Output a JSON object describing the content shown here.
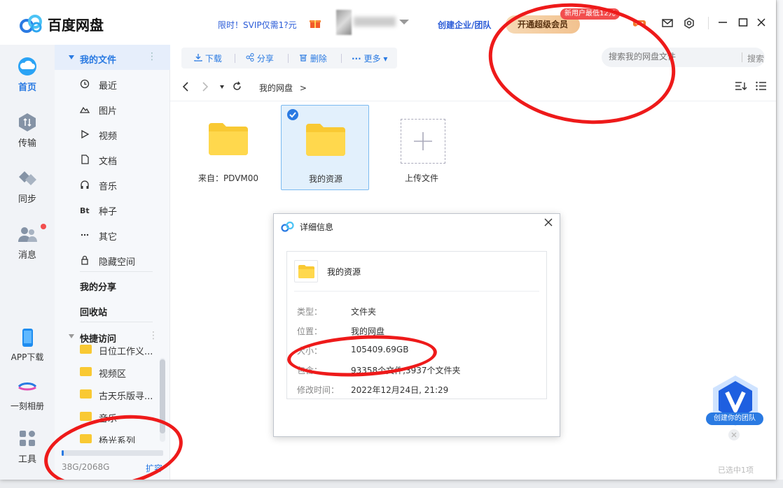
{
  "titlebar": {
    "app_title": "百度网盘",
    "promo": "限时！SVIP仅需1?元",
    "team_link": "创建企业/团队",
    "svip_button": "开通超级会员",
    "svip_badge": "新用户最低12元"
  },
  "leftnav": {
    "items": [
      {
        "label": "首页",
        "icon": "cloud-icon"
      },
      {
        "label": "传输",
        "icon": "transfer-icon"
      },
      {
        "label": "同步",
        "icon": "sync-icon"
      },
      {
        "label": "消息",
        "icon": "message-icon"
      },
      {
        "label": "APP下载",
        "icon": "phone-icon"
      },
      {
        "label": "一刻相册",
        "icon": "album-icon"
      },
      {
        "label": "工具",
        "icon": "tools-icon"
      }
    ]
  },
  "sidebar": {
    "my_files": "我的文件",
    "items": [
      "最近",
      "图片",
      "视频",
      "文档",
      "音乐",
      "种子",
      "其它",
      "隐藏空间"
    ],
    "my_share": "我的分享",
    "recycle": "回收站",
    "quick_access": "快捷访问",
    "quick_items": [
      "日位工作义...",
      "视频区",
      "古天乐版寻...",
      "音乐",
      "杨光系列"
    ],
    "storage": "38G/2068G",
    "storage_used_fraction": 0.018,
    "expand": "扩容"
  },
  "toolbar": {
    "download": "下载",
    "share": "分享",
    "delete": "删除",
    "more": "更多"
  },
  "search": {
    "placeholder": "搜索我的网盘文件",
    "button": "搜索"
  },
  "breadcrumb": {
    "path": "我的网盘",
    "sep": ">"
  },
  "files": [
    {
      "name": "来自：PDVM00",
      "selected": false
    },
    {
      "name": "我的资源",
      "selected": true
    },
    {
      "name": "上传文件",
      "selected": false
    }
  ],
  "dialog": {
    "title": "详细信息",
    "folder_name": "我的资源",
    "rows": [
      {
        "key": "类型：",
        "value": "文件夹"
      },
      {
        "key": "位置：",
        "value": "我的网盘"
      },
      {
        "key": "大小：",
        "value": "105409.69GB"
      },
      {
        "key": "包含：",
        "value": "93358个文件,3937个文件夹"
      },
      {
        "key": "修改时间：",
        "value": "2022年12月24日, 21:29"
      }
    ]
  },
  "team_widget": {
    "label": "创建你的团队"
  },
  "status": {
    "selected": "已选中1项"
  },
  "colors": {
    "accent": "#2a7ae2",
    "folder": "#f9c933",
    "annotation": "#ee1a1a"
  }
}
